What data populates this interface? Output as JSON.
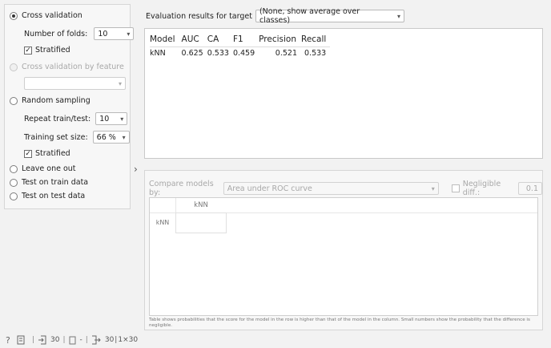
{
  "sampling": {
    "cross_validation": {
      "label": "Cross validation",
      "selected": true
    },
    "folds_label": "Number of folds:",
    "folds_value": "10",
    "stratified_label": "Stratified",
    "stratified_checked": "✓",
    "cv_by_feature_label": "Cross validation by feature",
    "cv_by_feature_value": "",
    "random_sampling_label": "Random sampling",
    "repeat_label": "Repeat train/test:",
    "repeat_value": "10",
    "training_size_label": "Training set size:",
    "training_size_value": "66 %",
    "stratified2_label": "Stratified",
    "stratified2_checked": "✓",
    "leave_one_out_label": "Leave one out",
    "test_on_train_label": "Test on train data",
    "test_on_test_label": "Test on test data"
  },
  "evaluation": {
    "target_label": "Evaluation results for target",
    "target_value": "(None, show average over classes)",
    "columns": [
      "Model",
      "AUC",
      "CA",
      "F1",
      "Precision",
      "Recall"
    ],
    "rows": [
      {
        "model": "kNN",
        "auc": "0.625",
        "ca": "0.533",
        "f1": "0.459",
        "precision": "0.521",
        "recall": "0.533"
      }
    ]
  },
  "compare": {
    "label": "Compare models by:",
    "metric_value": "Area under ROC curve",
    "negligible_label": "Negligible diff.:",
    "negligible_value": "0.1",
    "matrix_col": "kNN",
    "matrix_row": "kNN",
    "note": "Table shows probabilities that the score for the model in the row is higher than that of the model in the column. Small numbers show the probability that the difference is negligible."
  },
  "status": {
    "input_count": "30",
    "middle_count": "-",
    "output_count": "30",
    "output_dims": "1×30"
  },
  "icons": {
    "help": "help-icon",
    "report": "report-icon",
    "input": "input-data-icon",
    "output": "output-data-icon",
    "splitter": "splitter-arrow-icon"
  }
}
